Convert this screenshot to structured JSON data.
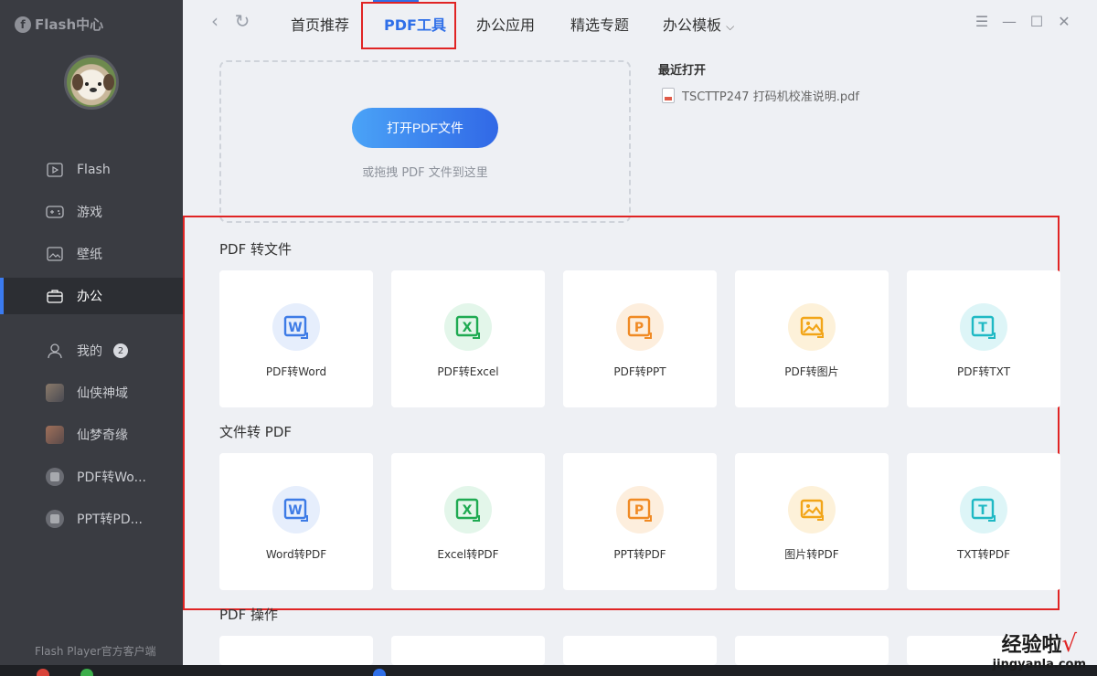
{
  "sidebar": {
    "logo_text": "Flash中心",
    "items": [
      {
        "label": "Flash",
        "icon": "play-icon"
      },
      {
        "label": "游戏",
        "icon": "gamepad-icon"
      },
      {
        "label": "壁纸",
        "icon": "wallpaper-icon"
      },
      {
        "label": "办公",
        "icon": "briefcase-icon",
        "active": true
      },
      {
        "label": "我的",
        "icon": "user-icon",
        "badge": "2"
      },
      {
        "label": "仙侠神域",
        "icon": "game-thumb-icon"
      },
      {
        "label": "仙梦奇缘",
        "icon": "game-thumb-icon"
      },
      {
        "label": "PDF转Wo...",
        "icon": "app-icon"
      },
      {
        "label": "PPT转PD...",
        "icon": "app-icon"
      }
    ],
    "footer": "Flash Player官方客户端"
  },
  "header": {
    "tabs": [
      {
        "label": "首页推荐"
      },
      {
        "label": "PDF工具",
        "active": true
      },
      {
        "label": "办公应用"
      },
      {
        "label": "精选专题"
      },
      {
        "label": "办公模板",
        "dropdown": true
      }
    ]
  },
  "drop_zone": {
    "button_label": "打开PDF文件",
    "hint": "或拖拽 PDF 文件到这里"
  },
  "recent": {
    "title": "最近打开",
    "files": [
      "TSCTTP247 打码机校准说明.pdf"
    ]
  },
  "sections": [
    {
      "title": "PDF 转文件",
      "cards": [
        {
          "label": "PDF转Word",
          "icon": "word-icon",
          "color": "#3d7be6",
          "bg": "#e6eefc",
          "letter": "W"
        },
        {
          "label": "PDF转Excel",
          "icon": "excel-icon",
          "color": "#1faa52",
          "bg": "#e3f6ea",
          "letter": "X"
        },
        {
          "label": "PDF转PPT",
          "icon": "ppt-icon",
          "color": "#f08a24",
          "bg": "#fdeedd",
          "letter": "P"
        },
        {
          "label": "PDF转图片",
          "icon": "image-icon",
          "color": "#f2a518",
          "bg": "#fdf1d9",
          "letter": ""
        },
        {
          "label": "PDF转TXT",
          "icon": "txt-icon",
          "color": "#1fb9c4",
          "bg": "#ddf5f7",
          "letter": "T"
        }
      ]
    },
    {
      "title": "文件转 PDF",
      "cards": [
        {
          "label": "Word转PDF",
          "icon": "word-icon",
          "color": "#3d7be6",
          "bg": "#e6eefc",
          "letter": "W"
        },
        {
          "label": "Excel转PDF",
          "icon": "excel-icon",
          "color": "#1faa52",
          "bg": "#e3f6ea",
          "letter": "X"
        },
        {
          "label": "PPT转PDF",
          "icon": "ppt-icon",
          "color": "#f08a24",
          "bg": "#fdeedd",
          "letter": "P"
        },
        {
          "label": "图片转PDF",
          "icon": "image-icon",
          "color": "#f2a518",
          "bg": "#fdf1d9",
          "letter": ""
        },
        {
          "label": "TXT转PDF",
          "icon": "txt-icon",
          "color": "#1fb9c4",
          "bg": "#ddf5f7",
          "letter": "T"
        }
      ]
    },
    {
      "title": "PDF 操作",
      "cards": []
    }
  ],
  "watermark": {
    "brand": "经验啦",
    "site": "jingyanla.com"
  },
  "colors": {
    "accent": "#2f6fe8",
    "highlight": "#e02424",
    "sidebar_bg": "#3a3c42"
  }
}
